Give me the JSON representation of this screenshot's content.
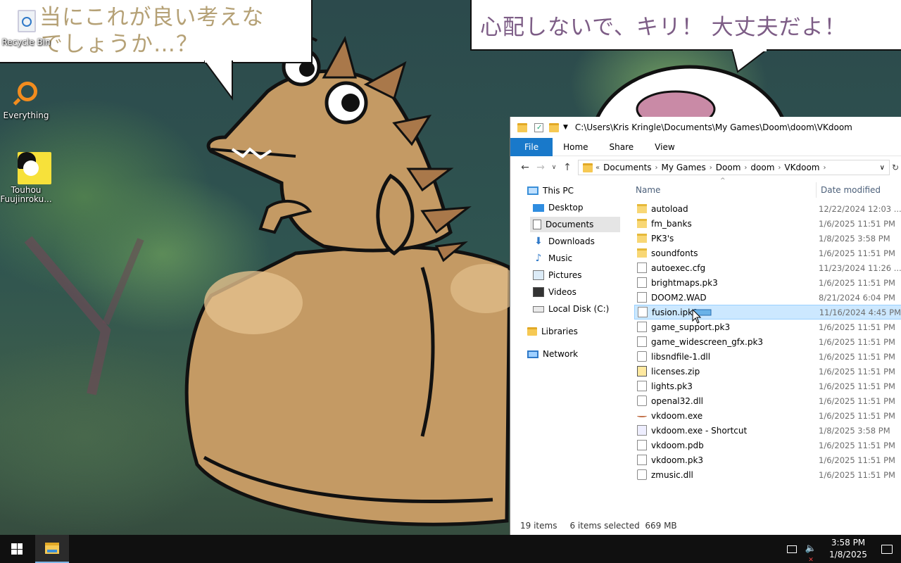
{
  "wallpaper": {
    "bubble_left_text": [
      "当にこれが良い考えな",
      "でしょうか…？"
    ],
    "bubble_right_text": "心配しないで、キリ！ 大丈夫だよ！"
  },
  "desktop_icons": [
    {
      "label": "Recycle Bin",
      "icon": "recycle-bin-icon"
    },
    {
      "label": "Everything",
      "icon": "everything-search-icon"
    },
    {
      "label": "Touhou Fuujinroku...",
      "icon": "touhou-game-icon"
    }
  ],
  "explorer": {
    "title_path": "C:\\Users\\Kris Kringle\\Documents\\My Games\\Doom\\doom\\VKdoom",
    "ribbon_tabs": [
      "File",
      "Home",
      "Share",
      "View"
    ],
    "breadcrumb": [
      "Documents",
      "My Games",
      "Doom",
      "doom",
      "VKdoom"
    ],
    "nav": {
      "this_pc": "This PC",
      "desktop": "Desktop",
      "documents": "Documents",
      "downloads": "Downloads",
      "music": "Music",
      "pictures": "Pictures",
      "videos": "Videos",
      "local_disk": "Local Disk (C:)",
      "libraries": "Libraries",
      "network": "Network"
    },
    "columns": {
      "name": "Name",
      "date": "Date modified"
    },
    "files": [
      {
        "name": "autoload",
        "date": "12/22/2024 12:03 ...",
        "type": "folder"
      },
      {
        "name": "fm_banks",
        "date": "1/6/2025 11:51 PM",
        "type": "folder"
      },
      {
        "name": "PK3's",
        "date": "1/8/2025 3:58 PM",
        "type": "folder"
      },
      {
        "name": "soundfonts",
        "date": "1/6/2025 11:51 PM",
        "type": "folder"
      },
      {
        "name": "autoexec.cfg",
        "date": "11/23/2024 11:26 ...",
        "type": "doc"
      },
      {
        "name": "brightmaps.pk3",
        "date": "1/6/2025 11:51 PM",
        "type": "doc"
      },
      {
        "name": "DOOM2.WAD",
        "date": "8/21/2024 6:04 PM",
        "type": "doc"
      },
      {
        "name": "fusion.ipk3",
        "date": "11/16/2024 4:45 PM",
        "type": "doc"
      },
      {
        "name": "game_support.pk3",
        "date": "1/6/2025 11:51 PM",
        "type": "doc"
      },
      {
        "name": "game_widescreen_gfx.pk3",
        "date": "1/6/2025 11:51 PM",
        "type": "doc"
      },
      {
        "name": "libsndfile-1.dll",
        "date": "1/6/2025 11:51 PM",
        "type": "gear"
      },
      {
        "name": "licenses.zip",
        "date": "1/6/2025 11:51 PM",
        "type": "zip"
      },
      {
        "name": "lights.pk3",
        "date": "1/6/2025 11:51 PM",
        "type": "doc"
      },
      {
        "name": "openal32.dll",
        "date": "1/6/2025 11:51 PM",
        "type": "gear"
      },
      {
        "name": "vkdoom.exe",
        "date": "1/6/2025 11:51 PM",
        "type": "exe"
      },
      {
        "name": "vkdoom.exe - Shortcut",
        "date": "1/8/2025 3:58 PM",
        "type": "lnk"
      },
      {
        "name": "vkdoom.pdb",
        "date": "1/6/2025 11:51 PM",
        "type": "doc"
      },
      {
        "name": "vkdoom.pk3",
        "date": "1/6/2025 11:51 PM",
        "type": "doc"
      },
      {
        "name": "zmusic.dll",
        "date": "1/6/2025 11:51 PM",
        "type": "gear"
      }
    ],
    "selected_row": "fusion.ipk3",
    "status": {
      "items": "19 items",
      "selected": "6 items selected  669 MB"
    }
  },
  "taskbar": {
    "time": "3:58 PM",
    "date": "1/8/2025"
  },
  "colors": {
    "accent": "#1979ca",
    "selection": "#cce8ff",
    "taskbar": "#101010"
  }
}
